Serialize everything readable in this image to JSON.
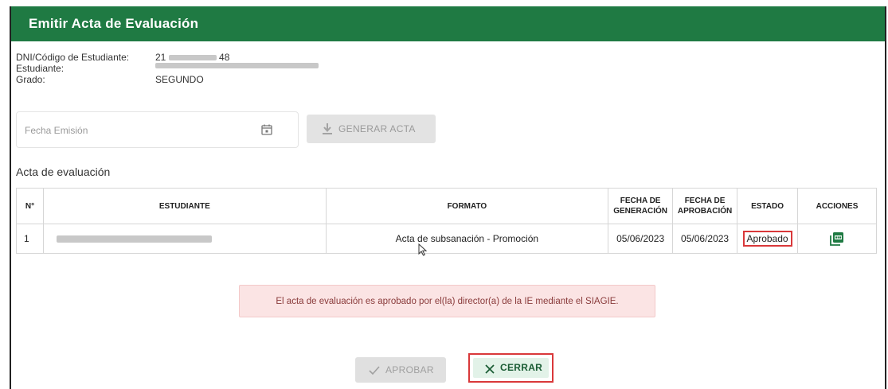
{
  "dialog": {
    "title": "Emitir Acta de Evaluación",
    "header_color": "#1f7a43"
  },
  "student_info": {
    "dni_label": "DNI/Código de Estudiante:",
    "dni_prefix": "21",
    "dni_suffix": "48",
    "student_label": "Estudiante:",
    "grade_label": "Grado:",
    "grade_value": "SEGUNDO"
  },
  "form": {
    "date_placeholder": "Fecha Emisión",
    "generate_button": "GENERAR ACTA"
  },
  "section": {
    "title": "Acta de evaluación"
  },
  "table": {
    "headers": {
      "num": "N°",
      "student": "ESTUDIANTE",
      "format": "FORMATO",
      "gen_date_1": "FECHA DE",
      "gen_date_2": "GENERACIÓN",
      "app_date_1": "FECHA DE",
      "app_date_2": "APROBACIÓN",
      "status": "ESTADO",
      "actions": "ACCIONES"
    },
    "rows": [
      {
        "num": "1",
        "format": "Acta de subsanación - Promoción",
        "generation_date": "05/06/2023",
        "approval_date": "05/06/2023",
        "status": "Aprobado",
        "action_icon": "pdf-icon"
      }
    ]
  },
  "notice": {
    "text": "El acta de evaluación es aprobado por el(la) director(a) de la IE mediante el SIAGIE.",
    "color": "#fbe4e4"
  },
  "footer": {
    "approve_button": "APROBAR",
    "close_button": "CERRAR"
  },
  "colors": {
    "highlight": "#d9383a",
    "accent": "#1f7a43"
  }
}
